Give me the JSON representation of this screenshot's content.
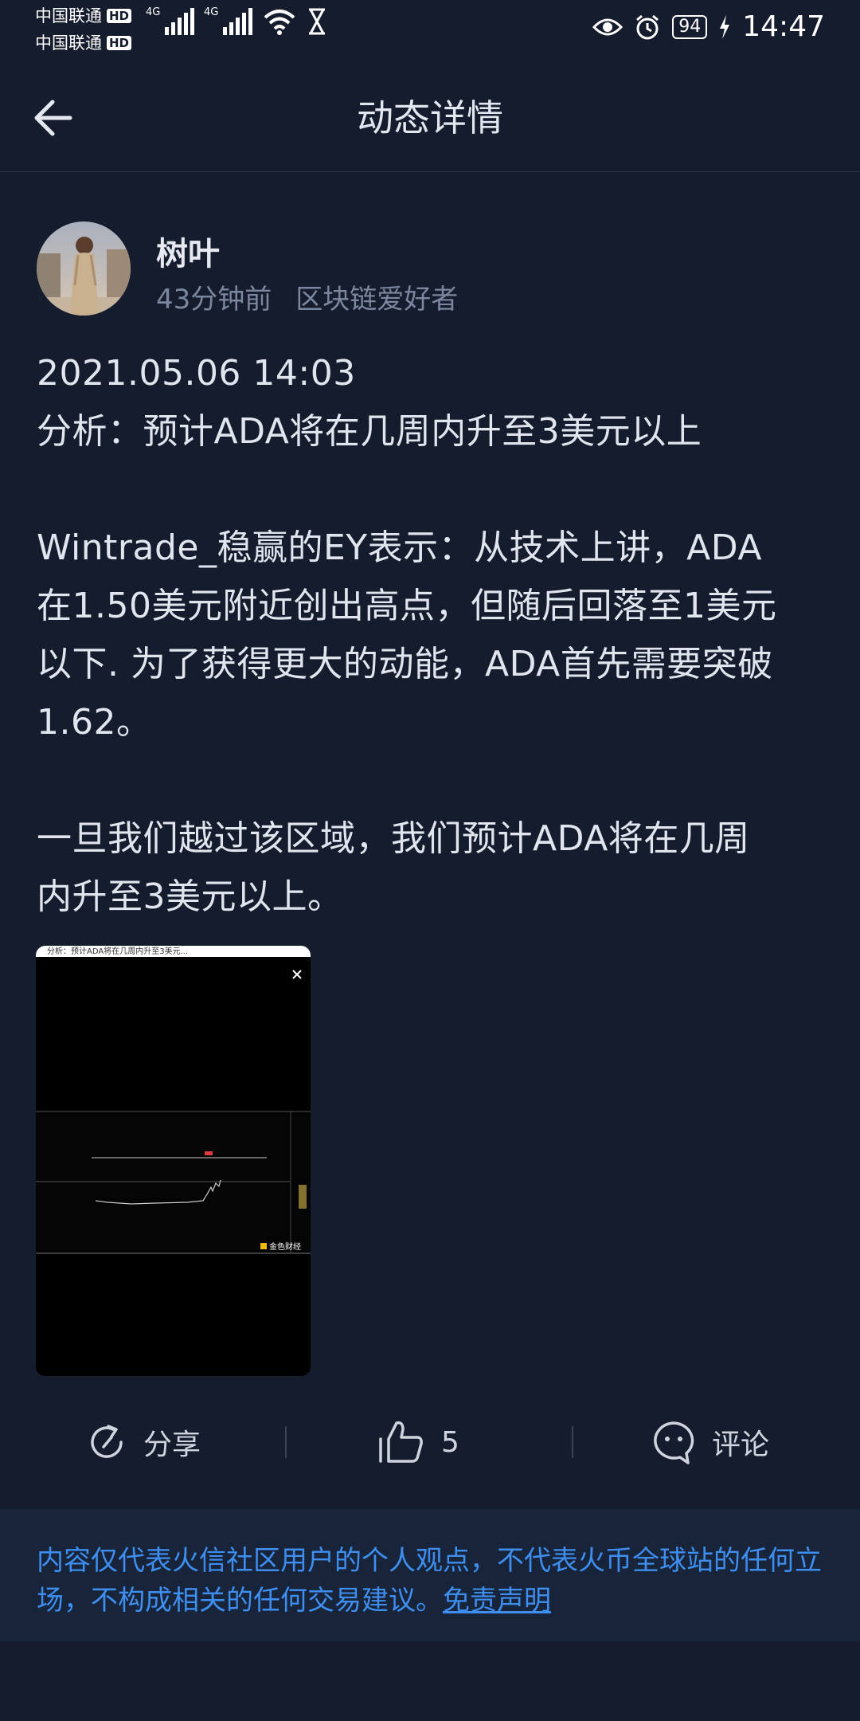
{
  "status_bar": {
    "carrier1": "中国联通",
    "carrier2": "中国联通",
    "hd": "HD",
    "net1": "4G",
    "net2": "4G",
    "battery": "94",
    "time": "14:47"
  },
  "header": {
    "title": "动态详情"
  },
  "author": {
    "name": "树叶",
    "time_ago": "43分钟前",
    "tag": "区块链爱好者"
  },
  "post": {
    "lines": [
      "2021.05.06 14:03",
      "分析：预计ADA将在几周内升至3美元以上",
      "",
      "Wintrade_稳赢的EY表示：从技术上讲，ADA",
      "在1.50美元附近创出高点，但随后回落至1美元",
      "以下. 为了获得更大的动能，ADA首先需要突破",
      "1.62。",
      "",
      "一旦我们越过该区域，我们预计ADA将在几周",
      "内升至3美元以上。"
    ]
  },
  "image": {
    "caption": "分析：预计ADA将在几周内升至3美元...",
    "watermark": "金色财经"
  },
  "actions": {
    "share_label": "分享",
    "like_count": "5",
    "comment_label": "评论"
  },
  "disclaimer": {
    "text": "内容仅代表火信社区用户的个人观点，不代表火币全球站的任何立场，不构成相关的任何交易建议。",
    "link": "免责声明"
  },
  "colors": {
    "background": "#151c2d",
    "disclaimer_bg": "#18243a",
    "link": "#3e8ef0"
  }
}
